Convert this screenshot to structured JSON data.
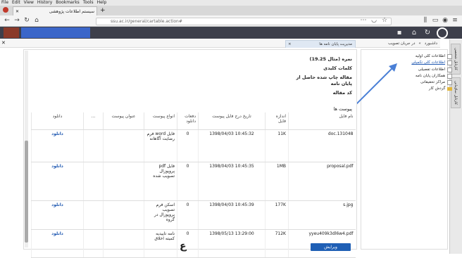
{
  "browser": {
    "menu": [
      "File",
      "Edit",
      "View",
      "History",
      "Bookmarks",
      "Tools",
      "Help"
    ],
    "tab_title": "سیستم اطلاعات پژوهشی",
    "url": "ssu.ac.ir/general/cartable.action#"
  },
  "breadcrumb": {
    "home": "داشبورد",
    "sep": "»",
    "current": "در جریان تصویب"
  },
  "app_tab": "مدیریت پایان نامه ها",
  "side_tabs": [
    "کارتابل شخصی",
    "کارتابل سازمانی"
  ],
  "tree": [
    {
      "label": "اطلاعات کلی اولیه"
    },
    {
      "label": "اطلاعات کلی تکمیلی"
    },
    {
      "label": "اطلاعات تفصیلی"
    },
    {
      "label": "همکاران پایان نامه"
    },
    {
      "label": "مراکز تحقیقاتی"
    },
    {
      "label": "گردش کار"
    }
  ],
  "form": {
    "score_label": "نمره (مثال 19.25)",
    "keywords_label": "کلمات کلیدی",
    "article_label": "مقاله چاپ شده حاصل از",
    "article_label2": "پایان نامه",
    "article_code_label": "کد مقاله",
    "attachments_label": "پیوست ها"
  },
  "table": {
    "headers": [
      "نام فایل",
      "اندازه فایل",
      "تاریخ درج فایل پیوست",
      "دفعات دانلود",
      "انواع پیوست",
      "عنوان پیوست",
      "...",
      "دانلود"
    ],
    "rows": [
      {
        "name": "doc.131048",
        "size": "11K",
        "date": "10:45:32  1398/04/03",
        "count": "0",
        "type": "فایل word فرم رضایت آگاهانه",
        "title": "",
        "dots": "",
        "dl": "دانلود"
      },
      {
        "name": "proposal.pdf",
        "size": "1MB",
        "date": "10:45:35  1398/04/03",
        "count": "0",
        "type": "فایل pdf پروپوزال تصویب شده",
        "title": "",
        "dots": "",
        "dl": "دانلود"
      },
      {
        "name": "s.jpg",
        "size": "177K",
        "date": "10:45:39  1398/04/03",
        "count": "0",
        "type": "اسکن فرم تصویب پروپوزال در گروه",
        "title": "",
        "dots": "",
        "dl": "دانلود"
      },
      {
        "name": "yyeu409k3dl6w4.pdf",
        "size": "712K",
        "date": "13:29:00  1398/05/13",
        "count": "0",
        "type": "نامه تاییدیه کمیته اخلاق",
        "title": "",
        "dots": "",
        "dl": "دانلود"
      }
    ]
  },
  "edit_button": "ویرایش",
  "bottom_char": "ع",
  "colors": {
    "header_dark": "#3d3f4b",
    "accent_blue": "#1f5fb5",
    "link": "#1c56b0"
  }
}
